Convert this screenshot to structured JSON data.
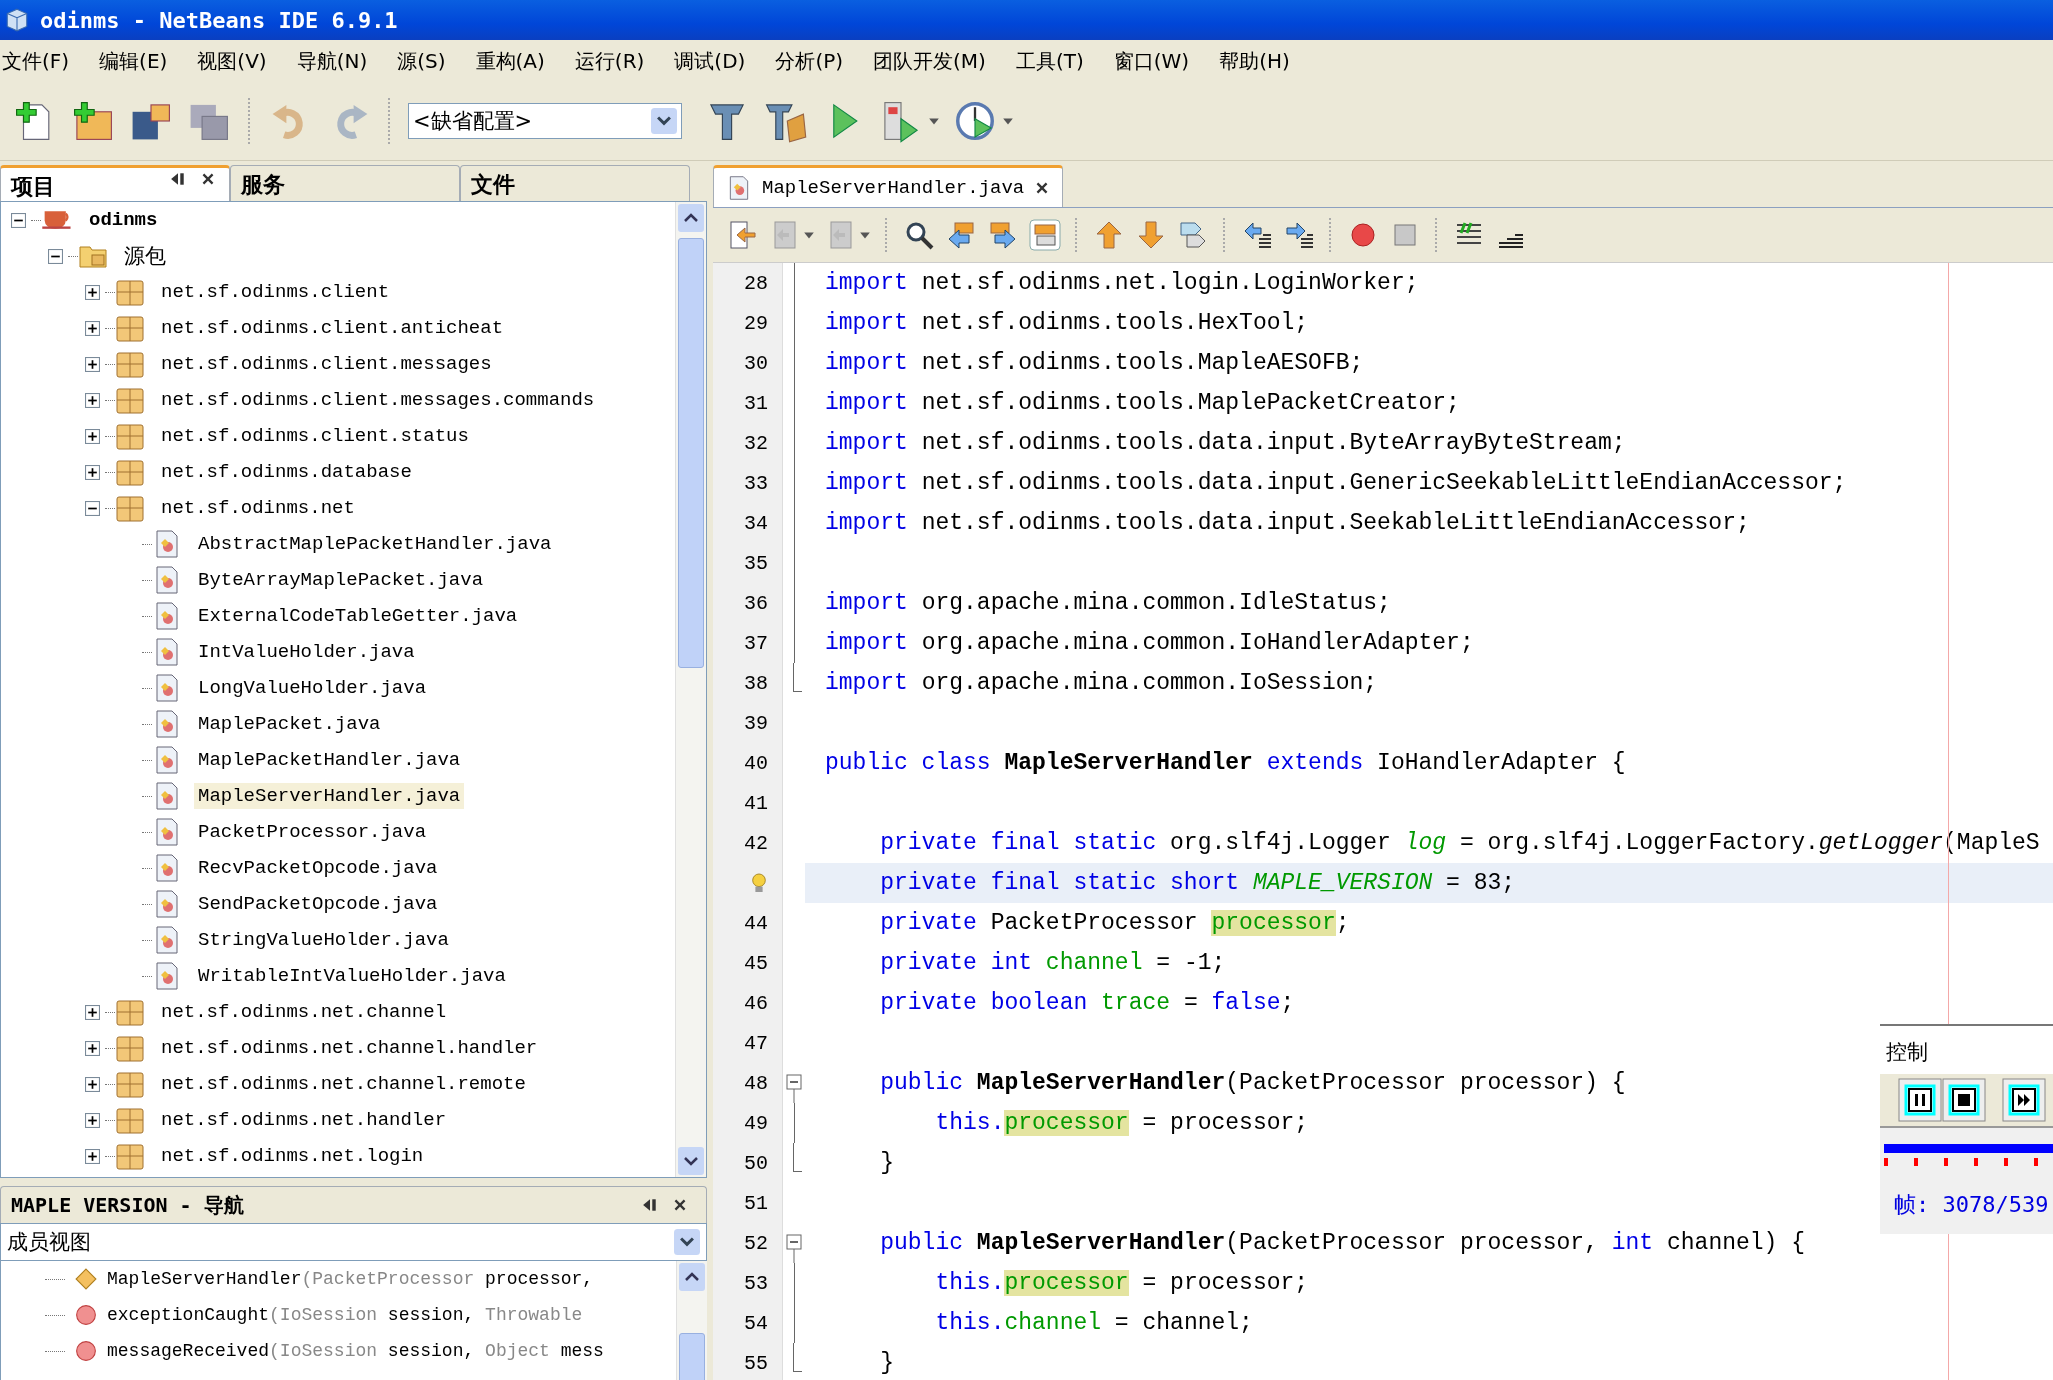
{
  "window": {
    "title": "odinms - NetBeans IDE 6.9.1"
  },
  "menu": [
    "文件(F)",
    "编辑(E)",
    "视图(V)",
    "导航(N)",
    "源(S)",
    "重构(A)",
    "运行(R)",
    "调试(D)",
    "分析(P)",
    "团队开发(M)",
    "工具(T)",
    "窗口(W)",
    "帮助(H)"
  ],
  "toolbar": {
    "configuration": "<缺省配置>"
  },
  "left_tabs": [
    {
      "label": "项目",
      "selected": true
    },
    {
      "label": "服务",
      "selected": false
    },
    {
      "label": "文件",
      "selected": false
    }
  ],
  "tree": [
    {
      "label": "odinms",
      "kind": "project",
      "expanded": true,
      "selected": false,
      "children": [
        {
          "label": "源包",
          "kind": "source-folder",
          "expanded": true,
          "selected": false,
          "children": [
            {
              "label": "net.sf.odinms.client",
              "kind": "package",
              "expanded": false,
              "selected": false
            },
            {
              "label": "net.sf.odinms.client.anticheat",
              "kind": "package",
              "expanded": false,
              "selected": false
            },
            {
              "label": "net.sf.odinms.client.messages",
              "kind": "package",
              "expanded": false,
              "selected": false
            },
            {
              "label": "net.sf.odinms.client.messages.commands",
              "kind": "package",
              "expanded": false,
              "selected": false
            },
            {
              "label": "net.sf.odinms.client.status",
              "kind": "package",
              "expanded": false,
              "selected": false
            },
            {
              "label": "net.sf.odinms.database",
              "kind": "package",
              "expanded": false,
              "selected": false
            },
            {
              "label": "net.sf.odinms.net",
              "kind": "package",
              "expanded": true,
              "selected": false,
              "children": [
                {
                  "label": "AbstractMaplePacketHandler.java",
                  "kind": "file",
                  "selected": false
                },
                {
                  "label": "ByteArrayMaplePacket.java",
                  "kind": "file",
                  "selected": false
                },
                {
                  "label": "ExternalCodeTableGetter.java",
                  "kind": "file",
                  "selected": false
                },
                {
                  "label": "IntValueHolder.java",
                  "kind": "file",
                  "selected": false
                },
                {
                  "label": "LongValueHolder.java",
                  "kind": "file",
                  "selected": false
                },
                {
                  "label": "MaplePacket.java",
                  "kind": "file",
                  "selected": false
                },
                {
                  "label": "MaplePacketHandler.java",
                  "kind": "file",
                  "selected": false
                },
                {
                  "label": "MapleServerHandler.java",
                  "kind": "file",
                  "selected": true
                },
                {
                  "label": "PacketProcessor.java",
                  "kind": "file",
                  "selected": false
                },
                {
                  "label": "RecvPacketOpcode.java",
                  "kind": "file",
                  "selected": false
                },
                {
                  "label": "SendPacketOpcode.java",
                  "kind": "file",
                  "selected": false
                },
                {
                  "label": "StringValueHolder.java",
                  "kind": "file",
                  "selected": false
                },
                {
                  "label": "WritableIntValueHolder.java",
                  "kind": "file",
                  "selected": false
                }
              ]
            },
            {
              "label": "net.sf.odinms.net.channel",
              "kind": "package",
              "expanded": false,
              "selected": false
            },
            {
              "label": "net.sf.odinms.net.channel.handler",
              "kind": "package",
              "expanded": false,
              "selected": false
            },
            {
              "label": "net.sf.odinms.net.channel.remote",
              "kind": "package",
              "expanded": false,
              "selected": false
            },
            {
              "label": "net.sf.odinms.net.handler",
              "kind": "package",
              "expanded": false,
              "selected": false
            },
            {
              "label": "net.sf.odinms.net.login",
              "kind": "package",
              "expanded": false,
              "selected": false
            }
          ]
        }
      ]
    }
  ],
  "navigator": {
    "title": "MAPLE VERSION - 导航",
    "view": "成员视图",
    "members": [
      {
        "kind": "constructor",
        "name": "MapleServerHandler",
        "params": [
          {
            "kind": "type",
            "text": "(PacketProcessor"
          },
          {
            "kind": "plain",
            "text": " processor,"
          }
        ]
      },
      {
        "kind": "method",
        "name": "exceptionCaught",
        "params": [
          {
            "kind": "type",
            "text": "(IoSession"
          },
          {
            "kind": "plain",
            "text": " session, "
          },
          {
            "kind": "type",
            "text": "Throwable"
          }
        ]
      },
      {
        "kind": "method",
        "name": "messageReceived",
        "params": [
          {
            "kind": "type",
            "text": "(IoSession"
          },
          {
            "kind": "plain",
            "text": " session, "
          },
          {
            "kind": "type",
            "text": "Object"
          },
          {
            "kind": "plain",
            "text": " mess"
          }
        ]
      }
    ]
  },
  "editor": {
    "tab": "MapleServerHandler.java",
    "lines": [
      {
        "number": "28",
        "current": false,
        "in_fold": true,
        "tokens": [
          {
            "kind": "keyword",
            "text": "import"
          },
          {
            "kind": "plain",
            "text": " net.sf.odinms.net.login.LoginWorker;"
          }
        ]
      },
      {
        "number": "29",
        "current": false,
        "in_fold": true,
        "tokens": [
          {
            "kind": "keyword",
            "text": "import"
          },
          {
            "kind": "plain",
            "text": " net.sf.odinms.tools.HexTool;"
          }
        ]
      },
      {
        "number": "30",
        "current": false,
        "in_fold": true,
        "tokens": [
          {
            "kind": "keyword",
            "text": "import"
          },
          {
            "kind": "plain",
            "text": " net.sf.odinms.tools.MapleAESOFB;"
          }
        ]
      },
      {
        "number": "31",
        "current": false,
        "in_fold": true,
        "tokens": [
          {
            "kind": "keyword",
            "text": "import"
          },
          {
            "kind": "plain",
            "text": " net.sf.odinms.tools.MaplePacketCreator;"
          }
        ]
      },
      {
        "number": "32",
        "current": false,
        "in_fold": true,
        "tokens": [
          {
            "kind": "keyword",
            "text": "import"
          },
          {
            "kind": "plain",
            "text": " net.sf.odinms.tools.data.input.ByteArrayByteStream;"
          }
        ]
      },
      {
        "number": "33",
        "current": false,
        "in_fold": true,
        "tokens": [
          {
            "kind": "keyword",
            "text": "import"
          },
          {
            "kind": "plain",
            "text": " net.sf.odinms.tools.data.input.GenericSeekableLittleEndianAccessor;"
          }
        ]
      },
      {
        "number": "34",
        "current": false,
        "in_fold": true,
        "tokens": [
          {
            "kind": "keyword",
            "text": "import"
          },
          {
            "kind": "plain",
            "text": " net.sf.odinms.tools.data.input.SeekableLittleEndianAccessor;"
          }
        ]
      },
      {
        "number": "35",
        "current": false,
        "in_fold": true
      },
      {
        "number": "36",
        "current": false,
        "in_fold": true,
        "tokens": [
          {
            "kind": "keyword",
            "text": "import"
          },
          {
            "kind": "plain",
            "text": " org.apache.mina.common.IdleStatus;"
          }
        ]
      },
      {
        "number": "37",
        "current": false,
        "in_fold": true,
        "tokens": [
          {
            "kind": "keyword",
            "text": "import"
          },
          {
            "kind": "plain",
            "text": " org.apache.mina.common.IoHandlerAdapter;"
          }
        ]
      },
      {
        "number": "38",
        "current": false,
        "fold_end": true,
        "tokens": [
          {
            "kind": "keyword",
            "text": "import"
          },
          {
            "kind": "plain",
            "text": " org.apache.mina.common.IoSession;"
          }
        ]
      },
      {
        "number": "39",
        "current": false
      },
      {
        "number": "40",
        "current": false,
        "tokens": [
          {
            "kind": "keyword",
            "text": "public class"
          },
          {
            "kind": "bold",
            "text": " MapleServerHandler"
          },
          {
            "kind": "keyword",
            "text": " extends"
          },
          {
            "kind": "plain",
            "text": " IoHandlerAdapter {"
          }
        ]
      },
      {
        "number": "41",
        "current": false
      },
      {
        "number": "42",
        "current": false,
        "tokens": [
          {
            "kind": "keyword",
            "text": "    private final static"
          },
          {
            "kind": "plain",
            "text": " org.slf4j.Logger "
          },
          {
            "kind": "static",
            "text": "log"
          },
          {
            "kind": "plain",
            "text": " = org.slf4j.LoggerFactory."
          },
          {
            "kind": "method",
            "text": "getLogger"
          },
          {
            "kind": "plain",
            "text": "(MapleS"
          }
        ]
      },
      {
        "hint": true,
        "current": true,
        "tokens": [
          {
            "kind": "keyword",
            "text": "    private final static short"
          },
          {
            "kind": "static",
            "text": " MAPLE_VERSION"
          },
          {
            "kind": "plain",
            "text": " = 83;"
          }
        ]
      },
      {
        "number": "44",
        "current": false,
        "tokens": [
          {
            "kind": "keyword",
            "text": "    private"
          },
          {
            "kind": "plain",
            "text": " PacketProcessor "
          },
          {
            "kind": "field-marked",
            "text": "processor"
          },
          {
            "kind": "plain",
            "text": ";"
          }
        ]
      },
      {
        "number": "45",
        "current": false,
        "tokens": [
          {
            "kind": "keyword",
            "text": "    private int"
          },
          {
            "kind": "field",
            "text": " channel"
          },
          {
            "kind": "plain",
            "text": " = -1;"
          }
        ]
      },
      {
        "number": "46",
        "current": false,
        "tokens": [
          {
            "kind": "keyword",
            "text": "    private boolean"
          },
          {
            "kind": "field",
            "text": " trace"
          },
          {
            "kind": "plain",
            "text": " = "
          },
          {
            "kind": "keyword",
            "text": "false"
          },
          {
            "kind": "plain",
            "text": ";"
          }
        ]
      },
      {
        "number": "47",
        "current": false
      },
      {
        "number": "48",
        "current": false,
        "fold_start": true,
        "tokens": [
          {
            "kind": "keyword",
            "text": "    public"
          },
          {
            "kind": "bold",
            "text": " MapleServerHandler"
          },
          {
            "kind": "plain",
            "text": "(PacketProcessor processor) {"
          }
        ]
      },
      {
        "number": "49",
        "current": false,
        "in_fold": true,
        "tokens": [
          {
            "kind": "keyword",
            "text": "        this."
          },
          {
            "kind": "field-marked",
            "text": "processor"
          },
          {
            "kind": "plain",
            "text": " = processor;"
          }
        ]
      },
      {
        "number": "50",
        "current": false,
        "fold_end": true,
        "tokens": [
          {
            "kind": "plain",
            "text": "    }"
          }
        ]
      },
      {
        "number": "51",
        "current": false
      },
      {
        "number": "52",
        "current": false,
        "fold_start": true,
        "tokens": [
          {
            "kind": "keyword",
            "text": "    public"
          },
          {
            "kind": "bold",
            "text": " MapleServerHandler"
          },
          {
            "kind": "plain",
            "text": "(PacketProcessor processor, "
          },
          {
            "kind": "keyword",
            "text": "int"
          },
          {
            "kind": "plain",
            "text": " channel) {"
          }
        ]
      },
      {
        "number": "53",
        "current": false,
        "in_fold": true,
        "tokens": [
          {
            "kind": "keyword",
            "text": "        this."
          },
          {
            "kind": "field-marked",
            "text": "processor"
          },
          {
            "kind": "plain",
            "text": " = processor;"
          }
        ]
      },
      {
        "number": "54",
        "current": false,
        "in_fold": true,
        "tokens": [
          {
            "kind": "keyword",
            "text": "        this."
          },
          {
            "kind": "field",
            "text": "channel"
          },
          {
            "kind": "plain",
            "text": " = channel;"
          }
        ]
      },
      {
        "number": "55",
        "current": false,
        "fold_end": true,
        "tokens": [
          {
            "kind": "plain",
            "text": "    }"
          }
        ]
      }
    ]
  },
  "recorder": {
    "title": "控制",
    "frame": "帧: 3078/539"
  }
}
